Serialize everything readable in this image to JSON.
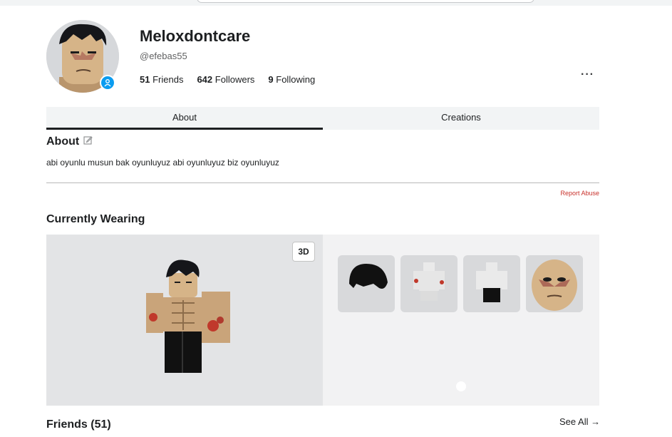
{
  "profile": {
    "display_name": "Meloxdontcare",
    "username": "@efebas55",
    "stats": [
      {
        "count": "51",
        "label": "Friends"
      },
      {
        "count": "642",
        "label": "Followers"
      },
      {
        "count": "9",
        "label": "Following"
      }
    ],
    "more_label": "···"
  },
  "tabs": [
    {
      "label": "About",
      "active": true
    },
    {
      "label": "Creations",
      "active": false
    }
  ],
  "about": {
    "title": "About",
    "text": "abi oyunlu musun bak oyunluyuz abi oyunluyuz biz oyunluyuz",
    "report_label": "Report Abuse"
  },
  "wearing": {
    "title": "Currently Wearing",
    "view_toggle": "3D",
    "items": [
      {
        "icon": "hair-icon"
      },
      {
        "icon": "shirt-icon"
      },
      {
        "icon": "pants-icon"
      },
      {
        "icon": "face-icon"
      }
    ]
  },
  "friends": {
    "title": "Friends (51)",
    "see_all": "See All →"
  },
  "colors": {
    "accent_blue": "#0a9cf0",
    "report_red": "#c8312b",
    "tab_bg": "#f2f4f5"
  }
}
